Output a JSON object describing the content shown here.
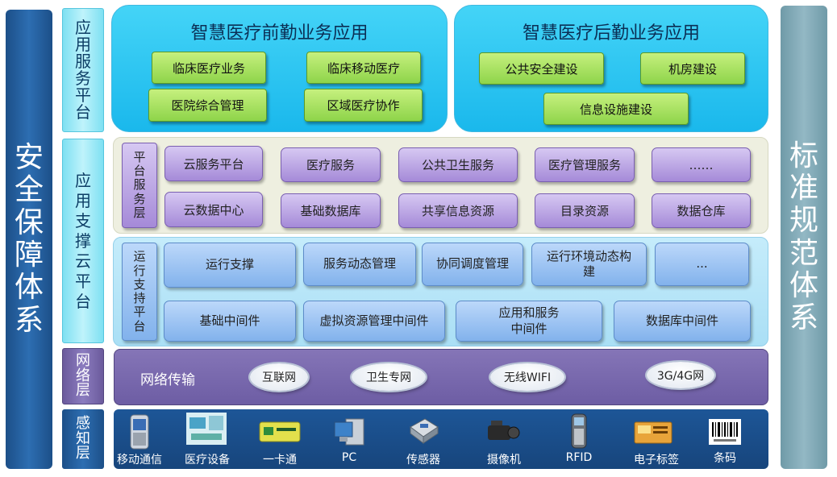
{
  "left_bar": {
    "chars": [
      "安",
      "全",
      "保",
      "障",
      "体",
      "系"
    ]
  },
  "right_bar": {
    "chars": [
      "标",
      "准",
      "规",
      "范",
      "体",
      "系"
    ]
  },
  "layer_labels": {
    "app_service": [
      "应",
      "用",
      "服",
      "务",
      "平",
      "台"
    ],
    "app_support": [
      "应",
      "用",
      "支",
      "撑",
      "云",
      "平",
      "台"
    ],
    "network": [
      "网",
      "络",
      "层"
    ],
    "perception": [
      "感",
      "知",
      "层"
    ]
  },
  "front_office": {
    "title": "智慧医疗前勤业务应用",
    "items": [
      "临床医疗业务",
      "临床移动医疗",
      "医院综合管理",
      "区域医疗协作"
    ]
  },
  "back_office": {
    "title": "智慧医疗后勤业务应用",
    "items": [
      "公共安全建设",
      "机房建设",
      "信息设施建设"
    ]
  },
  "platform_service": {
    "label": [
      "平",
      "台",
      "服",
      "务",
      "层"
    ],
    "items": [
      "云服务平台",
      "医疗服务",
      "公共卫生服务",
      "医疗管理服务",
      "……",
      "云数据中心",
      "基础数据库",
      "共享信息资源",
      "目录资源",
      "数据仓库"
    ]
  },
  "runtime_support": {
    "label": [
      "运",
      "行",
      "支",
      "持",
      "平",
      "台"
    ],
    "items": [
      "运行支撑",
      "服务动态管理",
      "协同调度管理",
      "运行环境动态构建",
      "...",
      "基础中间件",
      "虚拟资源管理中间件",
      "应用和服务中间件",
      "数据库中间件"
    ]
  },
  "network": {
    "title": "网络传输",
    "clouds": [
      "互联网",
      "卫生专网",
      "无线WIFI",
      "3G/4G网"
    ]
  },
  "devices": [
    {
      "label": "移动通信",
      "icon": "mobile-phone-icon"
    },
    {
      "label": "医疗设备",
      "icon": "medical-equipment-icon"
    },
    {
      "label": "一卡通",
      "icon": "smart-card-icon"
    },
    {
      "label": "PC",
      "icon": "pc-icon"
    },
    {
      "label": "传感器",
      "icon": "sensor-icon"
    },
    {
      "label": "摄像机",
      "icon": "camera-icon"
    },
    {
      "label": "RFID",
      "icon": "rfid-reader-icon"
    },
    {
      "label": "电子标签",
      "icon": "rfid-tag-icon"
    },
    {
      "label": "条码",
      "icon": "barcode-icon"
    }
  ]
}
